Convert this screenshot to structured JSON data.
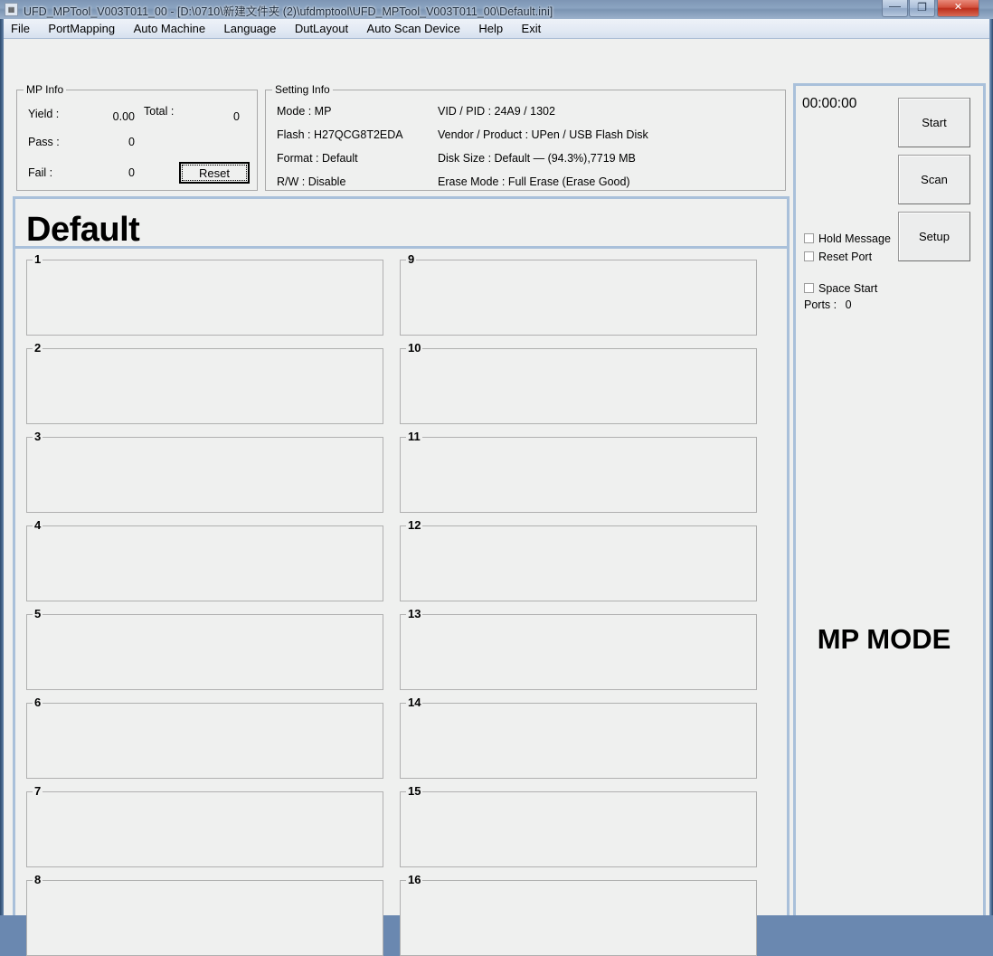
{
  "window": {
    "title": "UFD_MPTool_V003T011_00 - [D:\\0710\\新建文件夹 (2)\\ufdmptool\\UFD_MPTool_V003T011_00\\Default.ini]",
    "app_icon": "app-icon",
    "controls": {
      "minimize": "—",
      "maximize": "❐",
      "close": "✕"
    }
  },
  "menubar": {
    "items": [
      {
        "label": "File"
      },
      {
        "label": "PortMapping"
      },
      {
        "label": "Auto Machine"
      },
      {
        "label": "Language"
      },
      {
        "label": "DutLayout"
      },
      {
        "label": "Auto Scan Device"
      },
      {
        "label": "Help"
      },
      {
        "label": "Exit"
      }
    ]
  },
  "mp_info": {
    "legend": "MP Info",
    "yield_label": "Yield :",
    "yield_value": "0.00",
    "total_label": "Total :",
    "total_value": "0",
    "pass_label": "Pass :",
    "pass_value": "0",
    "fail_label": "Fail :",
    "fail_value": "0",
    "reset_label": "Reset"
  },
  "setting_info": {
    "legend": "Setting Info",
    "left_rows": [
      "Mode : MP",
      "Flash : H27QCG8T2EDA",
      "Format : Default",
      "R/W : Disable"
    ],
    "right_rows": [
      "VID / PID : 24A9 / 1302",
      "Vendor / Product : UPen / USB Flash Disk",
      "Disk Size : Default — (94.3%),7719 MB",
      "Erase Mode : Full Erase (Erase Good)"
    ]
  },
  "main": {
    "layout_title": "Default",
    "ports": [
      {
        "label": "1",
        "status": ""
      },
      {
        "label": "2",
        "status": ""
      },
      {
        "label": "3",
        "status": ""
      },
      {
        "label": "4",
        "status": ""
      },
      {
        "label": "5",
        "status": ""
      },
      {
        "label": "6",
        "status": ""
      },
      {
        "label": "7",
        "status": ""
      },
      {
        "label": "8",
        "status": ""
      },
      {
        "label": "9",
        "status": ""
      },
      {
        "label": "10",
        "status": ""
      },
      {
        "label": "11",
        "status": ""
      },
      {
        "label": "12",
        "status": ""
      },
      {
        "label": "13",
        "status": ""
      },
      {
        "label": "14",
        "status": ""
      },
      {
        "label": "15",
        "status": ""
      },
      {
        "label": "16",
        "status": ""
      }
    ]
  },
  "sidebar": {
    "timer": "00:00:00",
    "buttons": {
      "start": "Start",
      "scan": "Scan",
      "setup": "Setup"
    },
    "checkboxes": [
      {
        "label": "Hold Message",
        "checked": false
      },
      {
        "label": "Reset Port",
        "checked": false
      },
      {
        "label": "Space Start",
        "checked": false
      }
    ],
    "ports_label": "Ports :",
    "ports_value": "0",
    "mode_text": "MP MODE"
  },
  "colors": {
    "window_frame": "#a9c0da",
    "client_bg": "#eff0ef",
    "titlebar": "#8ba4c1",
    "close_button": "#c9392a",
    "groupbox_border": "#a9a9a9"
  }
}
